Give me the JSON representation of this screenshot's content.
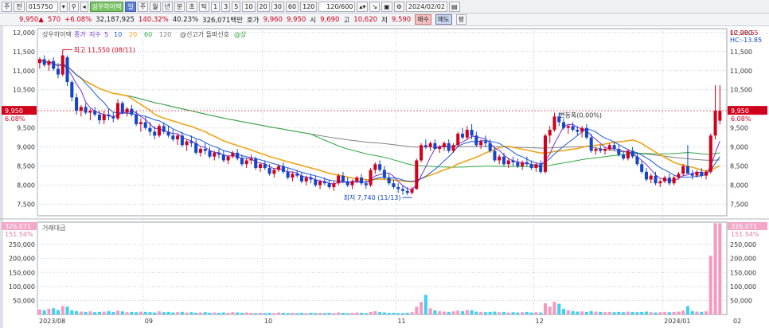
{
  "toolbar": {
    "items": [
      "주",
      "전",
      "015750",
      "성우하이텍",
      "일",
      "주",
      "월",
      "년",
      "분",
      "초",
      "틱",
      "1",
      "3",
      "5",
      "10",
      "20",
      "30",
      "60",
      "120",
      "120/600",
      "2024/02/02",
      "매수",
      "매도",
      "평"
    ]
  },
  "info": {
    "price": "9,950▲",
    "change": "570",
    "rate": "+6.08%",
    "volume": "32,187,925",
    "vol_ratio": "140.32%",
    "turnover": "40.23%",
    "amount": "326,071백만",
    "ask_label": "호가",
    "ask_value": "9,960",
    "bid_value": "9,950",
    "open_label": "시",
    "open_value": "9,690",
    "high_label": "고",
    "high_value": "10,620",
    "low_label": "저",
    "low_value": "9,590",
    "buy_label": "매수",
    "sell_label": "매도",
    "avg_label": "평"
  },
  "colors": {
    "up": "#d0021b",
    "down": "#1446c8",
    "ma5": "#7b2fd0",
    "ma10": "#1a5cd8",
    "ma20": "#f0a418",
    "ma60": "#2ea83f",
    "ma120": "#808080",
    "vol_up": "#f49ac0",
    "vol_dn": "#3ed0f0"
  },
  "chart_data": [
    {
      "type": "candlestick",
      "legend": [
        "성우하이텍",
        "종가",
        "지수",
        "5",
        "10",
        "20",
        "60",
        "120",
        "@신고가 돌파신호",
        "@상"
      ],
      "ylim": [
        7200,
        12100
      ],
      "y_ticks": [
        12000,
        11500,
        11000,
        10500,
        10000,
        9500,
        9000,
        8500,
        8000,
        7500
      ],
      "y_tick_labels": [
        "12,000",
        "11,500",
        "11,000",
        "10,500",
        "10,000",
        "9,500",
        "9,000",
        "8,500",
        "8,000",
        "7,500"
      ],
      "x_labels": [
        "2023/08",
        "09",
        "10",
        "11",
        "12",
        "2024/01",
        "02"
      ],
      "x_label_index": [
        0,
        23,
        49,
        78,
        108,
        136,
        164
      ],
      "right_top_labels": [
        "LC:28.55",
        "HC:-13.85"
      ],
      "current_price_label": "9,950",
      "current_rate_label": "6.08%",
      "annotations": [
        "최고 11,550 (08/11)",
        "최저 7,740 (11/13)",
        "변동폭(0.00%)"
      ],
      "high_index": 5,
      "high_value": 11550,
      "low_index": 81,
      "low_value": 7740,
      "ohlc": [
        [
          11200,
          11350,
          11050,
          11300
        ],
        [
          11300,
          11400,
          11100,
          11150
        ],
        [
          11150,
          11300,
          11000,
          11250
        ],
        [
          11250,
          11350,
          11000,
          11050
        ],
        [
          11050,
          11200,
          10800,
          10900
        ],
        [
          10900,
          11550,
          10850,
          11400
        ],
        [
          11350,
          11400,
          10600,
          10700
        ],
        [
          10700,
          10750,
          10200,
          10300
        ],
        [
          10300,
          10400,
          9850,
          9950
        ],
        [
          9950,
          10100,
          9800,
          10050
        ],
        [
          10050,
          10150,
          9850,
          9900
        ],
        [
          9900,
          10000,
          9700,
          9950
        ],
        [
          9950,
          10050,
          9800,
          9850
        ],
        [
          9850,
          9950,
          9600,
          9700
        ],
        [
          9700,
          9950,
          9600,
          9850
        ],
        [
          9850,
          10000,
          9700,
          9800
        ],
        [
          9800,
          9900,
          9650,
          9750
        ],
        [
          9750,
          10250,
          9700,
          10150
        ],
        [
          10150,
          10200,
          9850,
          9900
        ],
        [
          9900,
          10050,
          9800,
          10000
        ],
        [
          10000,
          10100,
          9800,
          9850
        ],
        [
          9850,
          9950,
          9550,
          9600
        ],
        [
          9600,
          9750,
          9400,
          9650
        ],
        [
          9650,
          9800,
          9450,
          9500
        ],
        [
          9500,
          9650,
          9300,
          9400
        ],
        [
          9400,
          9550,
          9200,
          9300
        ],
        [
          9300,
          9600,
          9250,
          9550
        ],
        [
          9550,
          9650,
          9350,
          9400
        ],
        [
          9400,
          9550,
          9250,
          9300
        ],
        [
          9300,
          9450,
          9150,
          9200
        ],
        [
          9200,
          9350,
          9050,
          9300
        ],
        [
          9300,
          9400,
          9000,
          9050
        ],
        [
          9050,
          9200,
          8900,
          9150
        ],
        [
          9150,
          9300,
          9000,
          9100
        ],
        [
          9100,
          9200,
          8800,
          8850
        ],
        [
          8850,
          9000,
          8750,
          8950
        ],
        [
          8950,
          9100,
          8800,
          8900
        ],
        [
          8900,
          9000,
          8700,
          8750
        ],
        [
          8750,
          8900,
          8650,
          8850
        ],
        [
          8850,
          8950,
          8700,
          8800
        ],
        [
          8800,
          8900,
          8600,
          8650
        ],
        [
          8650,
          8800,
          8550,
          8750
        ],
        [
          8750,
          8900,
          8700,
          8850
        ],
        [
          8850,
          8950,
          8650,
          8700
        ],
        [
          8700,
          8800,
          8500,
          8550
        ],
        [
          8550,
          8700,
          8450,
          8650
        ],
        [
          8650,
          8800,
          8550,
          8700
        ],
        [
          8700,
          8750,
          8400,
          8450
        ],
        [
          8450,
          8600,
          8350,
          8550
        ],
        [
          8550,
          8650,
          8400,
          8450
        ],
        [
          8450,
          8550,
          8250,
          8300
        ],
        [
          8300,
          8450,
          8200,
          8400
        ],
        [
          8400,
          8550,
          8350,
          8500
        ],
        [
          8500,
          8600,
          8300,
          8350
        ],
        [
          8350,
          8450,
          8150,
          8200
        ],
        [
          8200,
          8350,
          8100,
          8300
        ],
        [
          8300,
          8400,
          8200,
          8250
        ],
        [
          8250,
          8350,
          8050,
          8100
        ],
        [
          8100,
          8250,
          8000,
          8200
        ],
        [
          8200,
          8300,
          8050,
          8150
        ],
        [
          8150,
          8250,
          7950,
          8000
        ],
        [
          8000,
          8150,
          7900,
          8100
        ],
        [
          8100,
          8200,
          8000,
          8050
        ],
        [
          8050,
          8150,
          7900,
          7950
        ],
        [
          7950,
          8100,
          7850,
          8050
        ],
        [
          8050,
          8300,
          8000,
          8250
        ],
        [
          8250,
          8350,
          8050,
          8100
        ],
        [
          8100,
          8200,
          7950,
          8000
        ],
        [
          8000,
          8150,
          7900,
          8100
        ],
        [
          8100,
          8250,
          8050,
          8200
        ],
        [
          8200,
          8300,
          8000,
          8050
        ],
        [
          8050,
          8150,
          7900,
          8000
        ],
        [
          8000,
          8450,
          7950,
          8400
        ],
        [
          8400,
          8600,
          8300,
          8550
        ],
        [
          8550,
          8650,
          8350,
          8400
        ],
        [
          8400,
          8500,
          8150,
          8200
        ],
        [
          8200,
          8300,
          8000,
          8050
        ],
        [
          8050,
          8150,
          7900,
          7950
        ],
        [
          7950,
          8050,
          7800,
          7900
        ],
        [
          7900,
          8000,
          7750,
          7850
        ],
        [
          7850,
          7950,
          7740,
          7800
        ],
        [
          7800,
          7950,
          7760,
          7900
        ],
        [
          7900,
          8700,
          7880,
          8650
        ],
        [
          8650,
          9100,
          8600,
          9050
        ],
        [
          9050,
          9200,
          8950,
          9000
        ],
        [
          9000,
          9150,
          8900,
          9100
        ],
        [
          9100,
          9200,
          8950,
          8950
        ],
        [
          8950,
          9050,
          8850,
          9000
        ],
        [
          9000,
          9150,
          8900,
          9100
        ],
        [
          9100,
          9200,
          8850,
          8900
        ],
        [
          8900,
          9100,
          8850,
          9050
        ],
        [
          9050,
          9400,
          9000,
          9350
        ],
        [
          9350,
          9500,
          9200,
          9250
        ],
        [
          9250,
          9550,
          9200,
          9450
        ],
        [
          9450,
          9600,
          9200,
          9300
        ],
        [
          9300,
          9400,
          9000,
          9050
        ],
        [
          9050,
          9200,
          8950,
          9150
        ],
        [
          9150,
          9300,
          9000,
          9100
        ],
        [
          9100,
          9200,
          8850,
          8900
        ],
        [
          8900,
          9000,
          8600,
          8650
        ],
        [
          8650,
          8800,
          8550,
          8750
        ],
        [
          8750,
          8850,
          8500,
          8550
        ],
        [
          8550,
          8700,
          8450,
          8650
        ],
        [
          8650,
          8750,
          8500,
          8600
        ],
        [
          8600,
          8700,
          8450,
          8500
        ],
        [
          8500,
          8650,
          8400,
          8600
        ],
        [
          8600,
          8750,
          8500,
          8550
        ],
        [
          8550,
          8650,
          8400,
          8450
        ],
        [
          8450,
          8600,
          8350,
          8550
        ],
        [
          8550,
          8650,
          8300,
          8350
        ],
        [
          8350,
          9350,
          8300,
          9300
        ],
        [
          9300,
          9550,
          9100,
          9450
        ],
        [
          9450,
          9900,
          9400,
          9800
        ],
        [
          9800,
          9900,
          9550,
          9650
        ],
        [
          9650,
          9750,
          9450,
          9500
        ],
        [
          9500,
          9600,
          9350,
          9550
        ],
        [
          9550,
          9650,
          9400,
          9450
        ],
        [
          9450,
          9550,
          9300,
          9400
        ],
        [
          9400,
          9550,
          9250,
          9500
        ],
        [
          9500,
          9600,
          9200,
          9250
        ],
        [
          9250,
          9350,
          8850,
          8900
        ],
        [
          8900,
          9000,
          8800,
          8950
        ],
        [
          8950,
          9050,
          8850,
          8900
        ],
        [
          8900,
          9000,
          8800,
          8950
        ],
        [
          8950,
          9100,
          8900,
          9050
        ],
        [
          9050,
          9150,
          8900,
          8950
        ],
        [
          8950,
          9050,
          8750,
          8800
        ],
        [
          8800,
          8900,
          8650,
          8700
        ],
        [
          8700,
          8950,
          8650,
          8900
        ],
        [
          8900,
          9000,
          8700,
          8750
        ],
        [
          8750,
          8850,
          8500,
          8550
        ],
        [
          8550,
          8650,
          8300,
          8350
        ],
        [
          8350,
          8450,
          8100,
          8150
        ],
        [
          8150,
          8300,
          8050,
          8250
        ],
        [
          8250,
          8350,
          8000,
          8050
        ],
        [
          8050,
          8150,
          7950,
          8100
        ],
        [
          8100,
          8250,
          8050,
          8200
        ],
        [
          8200,
          8300,
          8000,
          8050
        ],
        [
          8050,
          8250,
          8000,
          8200
        ],
        [
          8200,
          8350,
          8150,
          8300
        ],
        [
          8300,
          8550,
          8250,
          8500
        ],
        [
          8500,
          9050,
          8450,
          8300
        ],
        [
          8300,
          8400,
          8150,
          8250
        ],
        [
          8250,
          8400,
          8200,
          8350
        ],
        [
          8350,
          8450,
          8200,
          8250
        ],
        [
          8250,
          8400,
          8150,
          8350
        ],
        [
          8350,
          9350,
          8300,
          9300
        ],
        [
          9300,
          10620,
          9200,
          9950
        ],
        [
          9690,
          10620,
          9590,
          9950
        ]
      ],
      "volume": {
        "label": "거래대금",
        "ylim": [
          0,
          330000
        ],
        "y_ticks": [
          250000,
          200000,
          150000,
          100000,
          50000
        ],
        "y_tick_labels": [
          "250,000",
          "200,000",
          "150,000",
          "100,000",
          "50,000"
        ],
        "top_labels": [
          "326,071",
          "151.54%"
        ],
        "values": [
          18000,
          15000,
          20000,
          22000,
          16000,
          30000,
          28000,
          15000,
          12000,
          10000,
          9000,
          11000,
          8000,
          9000,
          10000,
          12000,
          9000,
          14000,
          11000,
          8000,
          9000,
          8000,
          10000,
          9000,
          8000,
          7000,
          11000,
          8000,
          9000,
          7000,
          8000,
          9000,
          7000,
          8000,
          6000,
          7000,
          8000,
          6000,
          7000,
          6000,
          7000,
          6000,
          8000,
          7000,
          6000,
          7000,
          6000,
          5000,
          6000,
          5000,
          6000,
          5000,
          7000,
          6000,
          5000,
          6000,
          5000,
          6000,
          5000,
          6000,
          5000,
          6000,
          5000,
          6000,
          5000,
          7000,
          6000,
          5000,
          6000,
          7000,
          6000,
          5000,
          9000,
          12000,
          8000,
          7000,
          6000,
          6000,
          5000,
          5000,
          6000,
          8000,
          28000,
          45000,
          70000,
          22000,
          15000,
          12000,
          10000,
          9000,
          11000,
          14000,
          12000,
          16000,
          15000,
          10000,
          9000,
          8000,
          9000,
          10000,
          8000,
          9000,
          7000,
          8000,
          7000,
          8000,
          9000,
          7000,
          8000,
          7000,
          40000,
          28000,
          45000,
          38000,
          20000,
          15000,
          12000,
          10000,
          11000,
          9000,
          12000,
          10000,
          9000,
          8000,
          9000,
          8000,
          9000,
          8000,
          10000,
          9000,
          8000,
          9000,
          10000,
          8000,
          7000,
          8000,
          9000,
          8000,
          9000,
          10000,
          14000,
          30000,
          12000,
          10000,
          9000,
          11000,
          210000,
          326071,
          326071
        ]
      }
    }
  ]
}
